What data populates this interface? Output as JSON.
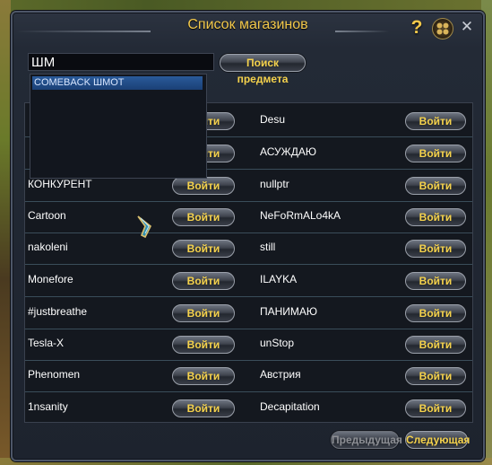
{
  "window": {
    "title": "Список магазинов"
  },
  "search": {
    "value": "ШМ",
    "button_label": "Поиск предмета"
  },
  "dropdown": {
    "items": [
      "COMEBACK ШМОТ"
    ]
  },
  "shops": {
    "enter_label": "Войти",
    "left": [
      "",
      "",
      "КОНКУРЕНТ",
      "Cartoon",
      "nakoleni",
      "Monefore",
      "#justbreathe",
      "Tesla-X",
      "Phenomen",
      "1nsanity"
    ],
    "right": [
      "Desu",
      "АСУЖДАЮ",
      "nullptr",
      "NeFoRmALo4kA",
      "still",
      "ILAYKA",
      "ПАНИМАЮ",
      "unStop",
      "Австрия",
      "Decapitation"
    ]
  },
  "pagination": {
    "prev_label": "Предыдущая",
    "next_label": "Следующая",
    "prev_disabled": true
  },
  "icons": {
    "help": "question-mark",
    "menu": "four-slot-menu",
    "close": "x",
    "badge": "crystal-emblem"
  },
  "colors": {
    "accent_gold": "#f5d24c",
    "title_gold": "#f2c84b",
    "selection_blue": "#2a5a9a"
  }
}
